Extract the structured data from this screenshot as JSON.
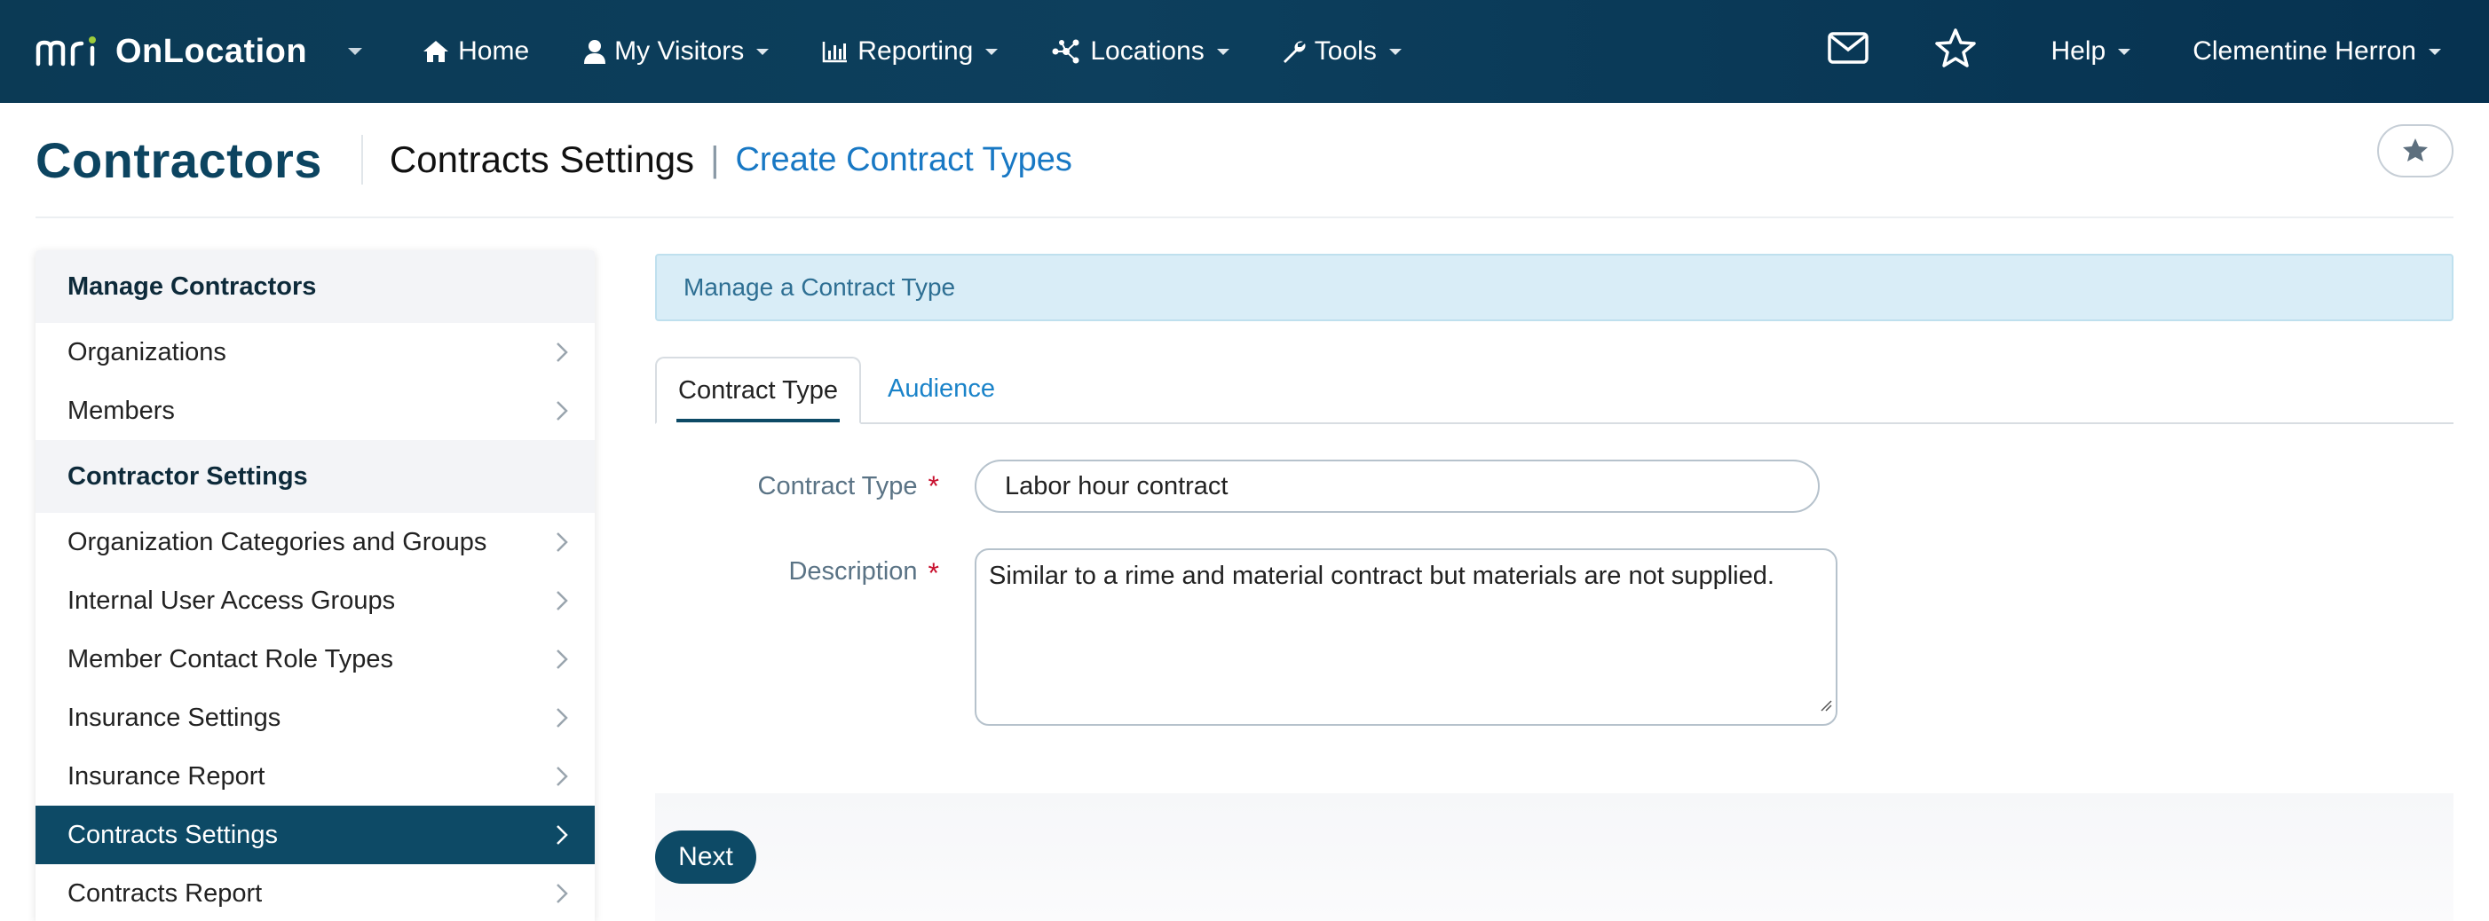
{
  "navbar": {
    "brand_logo": "mri",
    "brand_name": "OnLocation",
    "items": [
      {
        "label": "Home",
        "icon": "home-icon"
      },
      {
        "label": "My Visitors",
        "icon": "user-icon"
      },
      {
        "label": "Reporting",
        "icon": "bar-chart-icon"
      },
      {
        "label": "Locations",
        "icon": "network-icon"
      },
      {
        "label": "Tools",
        "icon": "wrench-icon"
      }
    ],
    "help_label": "Help",
    "user_name": "Clementine Herron"
  },
  "header": {
    "title": "Contractors",
    "section": "Contracts Settings",
    "separator": "|",
    "crumb_link": "Create Contract Types"
  },
  "sidebar": {
    "groups": [
      {
        "heading": "Manage Contractors",
        "items": [
          {
            "label": "Organizations"
          },
          {
            "label": "Members"
          }
        ]
      },
      {
        "heading": "Contractor Settings",
        "items": [
          {
            "label": "Organization Categories and Groups"
          },
          {
            "label": "Internal User Access Groups"
          },
          {
            "label": "Member Contact Role Types"
          },
          {
            "label": "Insurance Settings"
          },
          {
            "label": "Insurance Report"
          },
          {
            "label": "Contracts Settings",
            "active": true
          },
          {
            "label": "Contracts Report"
          }
        ]
      }
    ]
  },
  "main": {
    "alert": "Manage a Contract Type",
    "tabs": [
      {
        "label": "Contract Type",
        "active": true
      },
      {
        "label": "Audience"
      }
    ],
    "form": {
      "contract_type_label": "Contract Type",
      "contract_type_value": "Labor hour contract",
      "description_label": "Description",
      "description_value": "Similar to a rime and material contract but materials are not supplied.",
      "required_mark": "*"
    },
    "next_label": "Next"
  },
  "colors": {
    "navbar": "#0b3a55",
    "primary": "#0d4a66",
    "link": "#1878c4",
    "alert_bg": "#d9edf7",
    "required": "#c8102e"
  }
}
